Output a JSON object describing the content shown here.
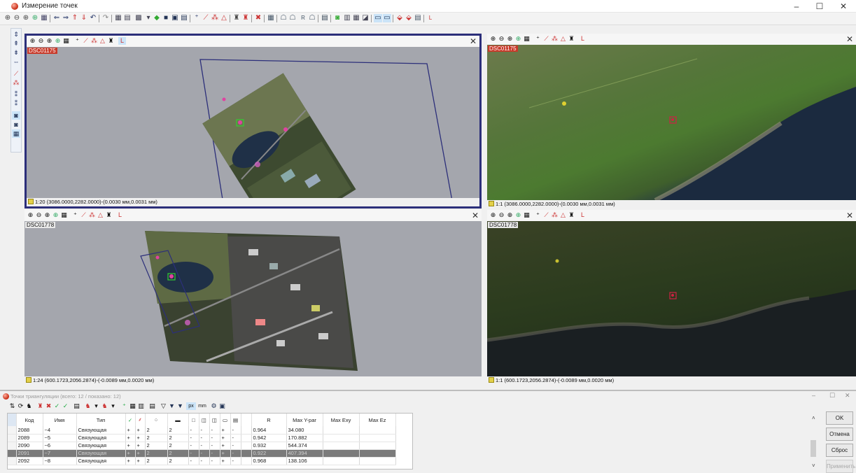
{
  "window": {
    "title": "Измерение точек",
    "minimize": "–",
    "maximize": "☐",
    "close": "✕"
  },
  "toolbar": {
    "icons": [
      "zoom-in-icon",
      "zoom-out-icon",
      "zoom-fit-icon",
      "zoom-select-icon",
      "grid-icon",
      "arrow-left-icon",
      "arrow-right-icon",
      "arrow-up-icon",
      "arrow-down-icon",
      "undo-icon",
      "redo-icon",
      "tile-icon",
      "tile-alt-icon",
      "filter-icon",
      "point-icon",
      "folder-icon",
      "image-icon",
      "add-point-icon",
      "pen-icon",
      "measure-icon",
      "triangle-icon",
      "user-icon",
      "user-alt-icon",
      "cross-icon",
      "list-icon",
      "check-icon",
      "check-alt-icon",
      "r-icon",
      "table-icon",
      "doc-icon",
      "stack-icon",
      "bars-icon",
      "pin-icon",
      "view-icon",
      "monitor-icon",
      "link-icon",
      "link-alt-icon",
      "save-icon",
      "l-icon"
    ]
  },
  "panes": {
    "top_left": {
      "image": "DSC01175",
      "status": "1:20 (3086.0000,2282.0000)-(0.0030 мм,0.0031 мм)",
      "close": "✕"
    },
    "top_right": {
      "image": "DSC01175",
      "status": "1:1 (3086.0000,2282.0000)-(0.0030 мм,0.0031 мм)",
      "close": "✕"
    },
    "bottom_left": {
      "image": "DSC01778",
      "status": "1:24 (600.1723,2056.2874)-(-0.0089 мм,0.0020 мм)",
      "close": "✕"
    },
    "bottom_right": {
      "image": "DSC01778",
      "status": "1:1 (600.1723,2056.2874)-(-0.0089 мм,0.0020 мм)",
      "close": "✕"
    }
  },
  "pane_toolbar_label": "L",
  "dialog": {
    "title": "Точки триангуляции (всего: 12 / показано: 12)",
    "toolbar_units": [
      "px",
      "mm"
    ],
    "columns": [
      "Код",
      "Имя",
      "Тип",
      "",
      "",
      "",
      "",
      "",
      "",
      "",
      "",
      "",
      "",
      "",
      "R",
      "Max Y-par",
      "Max Exy",
      "Max Ez"
    ],
    "rows": [
      {
        "code": "2088",
        "name": "~4",
        "type": "Связующая",
        "c1": "+",
        "c2": "+",
        "c3": "2",
        "c4": "2",
        "c5": "-",
        "c6": "-",
        "c7": "-",
        "c8": "+",
        "c9": "-",
        "r": "0.964",
        "ypar": "34.080"
      },
      {
        "code": "2089",
        "name": "~5",
        "type": "Связующая",
        "c1": "+",
        "c2": "+",
        "c3": "2",
        "c4": "2",
        "c5": "-",
        "c6": "-",
        "c7": "-",
        "c8": "+",
        "c9": "-",
        "r": "0.942",
        "ypar": "170.882"
      },
      {
        "code": "2090",
        "name": "~6",
        "type": "Связующая",
        "c1": "+",
        "c2": "+",
        "c3": "2",
        "c4": "2",
        "c5": "-",
        "c6": "-",
        "c7": "-",
        "c8": "+",
        "c9": "-",
        "r": "0.932",
        "ypar": "544.374"
      },
      {
        "code": "2091",
        "name": "~7",
        "type": "Связующая",
        "c1": "+",
        "c2": "+",
        "c3": "2",
        "c4": "2",
        "c5": "-",
        "c6": "-",
        "c7": "-",
        "c8": "+",
        "c9": "-",
        "r": "0.922",
        "ypar": "407.394"
      },
      {
        "code": "2092",
        "name": "~8",
        "type": "Связующая",
        "c1": "+",
        "c2": "+",
        "c3": "2",
        "c4": "2",
        "c5": "-",
        "c6": "-",
        "c7": "-",
        "c8": "+",
        "c9": "-",
        "r": "0.968",
        "ypar": "138.106"
      }
    ],
    "buttons": {
      "ok": "OK",
      "cancel": "Отмена",
      "reset": "Сброс",
      "apply": "Применить"
    }
  },
  "colors": {
    "accent": "#2c2f7a",
    "selection": "#7b7b7b",
    "grass": "#4f7a34",
    "water": "#1f3047"
  }
}
